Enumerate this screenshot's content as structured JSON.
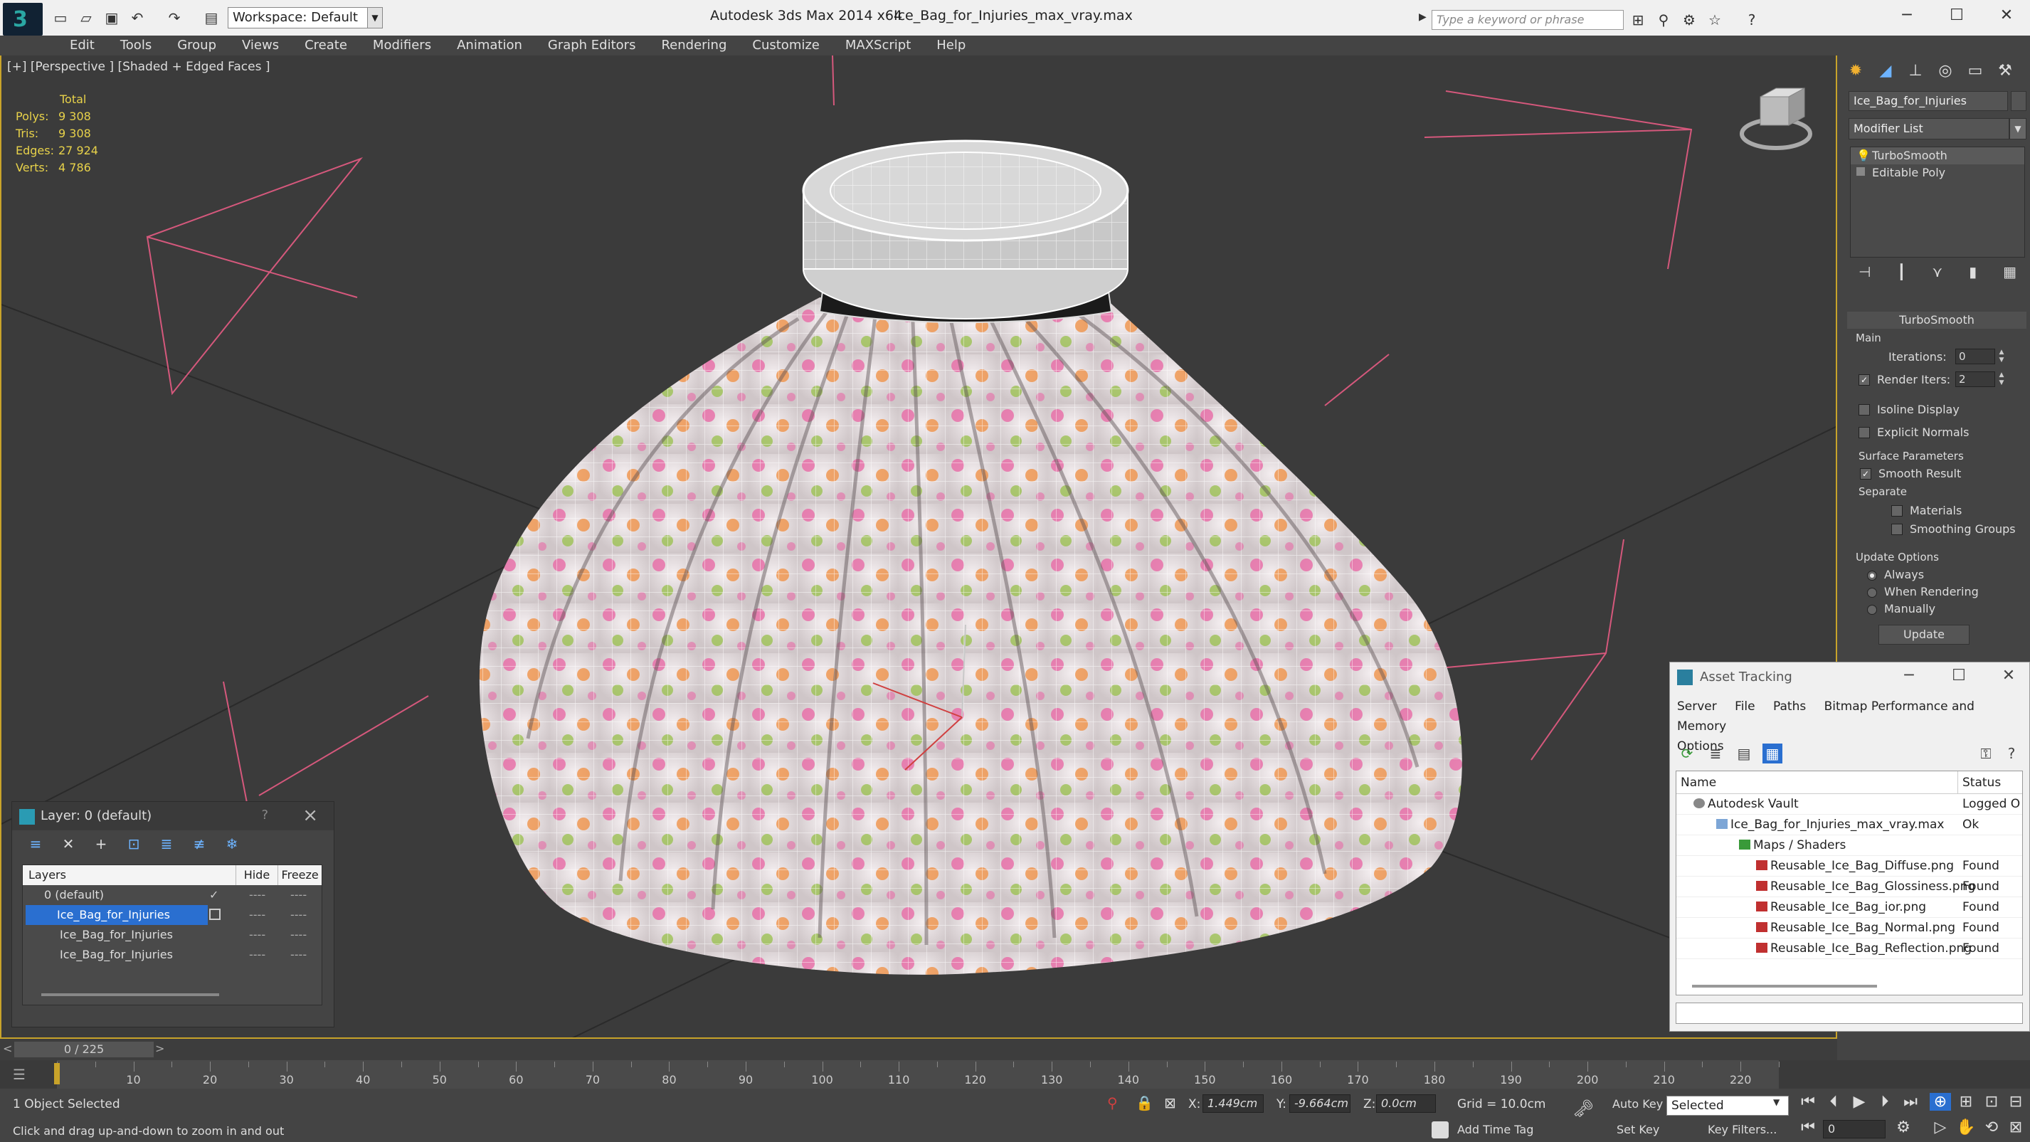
{
  "titlebar": {
    "workspace": "Workspace: Default",
    "app_title": "Autodesk 3ds Max  2014 x64",
    "file_title": "Ice_Bag_for_Injuries_max_vray.max",
    "search_placeholder": "Type a keyword or phrase"
  },
  "menu": [
    "Edit",
    "Tools",
    "Group",
    "Views",
    "Create",
    "Modifiers",
    "Animation",
    "Graph Editors",
    "Rendering",
    "Customize",
    "MAXScript",
    "Help"
  ],
  "viewport": {
    "label": "[+] [Perspective ] [Shaded + Edged Faces ]",
    "stats_header": "Total",
    "stats": [
      {
        "k": "Polys:",
        "v": "9 308"
      },
      {
        "k": "Tris:",
        "v": "9 308"
      },
      {
        "k": "Edges:",
        "v": "27 924"
      },
      {
        "k": "Verts:",
        "v": "4 786"
      }
    ]
  },
  "layer_dialog": {
    "title": "Layer: 0 (default)",
    "help": "?",
    "col_layers": "Layers",
    "col_hide": "Hide",
    "col_freeze": "Freeze",
    "rows": [
      {
        "name": "0 (default)",
        "hide": "----",
        "freeze": "----"
      },
      {
        "name": "Ice_Bag_for_Injuries",
        "hide": "----",
        "freeze": "----"
      },
      {
        "name": "Ice_Bag_for_Injuries",
        "hide": "----",
        "freeze": "----"
      },
      {
        "name": "Ice_Bag_for_Injuries",
        "hide": "----",
        "freeze": "----"
      }
    ]
  },
  "command_panel": {
    "object_name": "Ice_Bag_for_Injuries",
    "modifier_list": "Modifier List",
    "stack": [
      "TurboSmooth",
      "Editable Poly"
    ],
    "rollout": "TurboSmooth",
    "main": "Main",
    "iterations_label": "Iterations:",
    "iterations": "0",
    "render_iters_label": "Render Iters:",
    "render_iters": "2",
    "isoline": "Isoline Display",
    "explicit_normals": "Explicit Normals",
    "surface_params": "Surface Parameters",
    "smooth_result": "Smooth Result",
    "separate": "Separate",
    "materials": "Materials",
    "smoothing_groups": "Smoothing Groups",
    "update_options": "Update Options",
    "always": "Always",
    "when_rendering": "When Rendering",
    "manually": "Manually",
    "update": "Update"
  },
  "asset_tracking": {
    "title": "Asset Tracking",
    "menu": [
      "Server",
      "File",
      "Paths",
      "Bitmap Performance and Memory",
      "Options"
    ],
    "col_name": "Name",
    "col_status": "Status",
    "rows": [
      {
        "name": "Autodesk Vault",
        "status": "Logged O"
      },
      {
        "name": "Ice_Bag_for_Injuries_max_vray.max",
        "status": "Ok"
      },
      {
        "name": "Maps / Shaders",
        "status": ""
      },
      {
        "name": "Reusable_Ice_Bag_Diffuse.png",
        "status": "Found"
      },
      {
        "name": "Reusable_Ice_Bag_Glossiness.png",
        "status": "Found"
      },
      {
        "name": "Reusable_Ice_Bag_ior.png",
        "status": "Found"
      },
      {
        "name": "Reusable_Ice_Bag_Normal.png",
        "status": "Found"
      },
      {
        "name": "Reusable_Ice_Bag_Reflection.png",
        "status": "Found"
      }
    ]
  },
  "timeline": {
    "position": "0 / 225",
    "ticks": [
      "10",
      "20",
      "30",
      "40",
      "50",
      "60",
      "70",
      "80",
      "90",
      "100",
      "110",
      "120",
      "130",
      "140",
      "150",
      "160",
      "170",
      "180",
      "190",
      "200",
      "210",
      "220"
    ]
  },
  "status": {
    "selected": "1 Object Selected",
    "prompt": "Click and drag up-and-down to zoom in and out",
    "x_label": "X:",
    "x": "1.449cm",
    "y_label": "Y:",
    "y": "-9.664cm",
    "z_label": "Z:",
    "z": "0.0cm",
    "grid": "Grid = 10.0cm",
    "add_time_tag": "Add Time Tag",
    "auto_key": "Auto Key",
    "set_key": "Set Key",
    "selected_dd": "Selected",
    "key_filters": "Key Filters...",
    "frame": "0"
  },
  "colors": {
    "accent_yellow": "#c8a32a",
    "selection_blue": "#2a6fd0",
    "stats_yellow": "#e8d24a"
  }
}
